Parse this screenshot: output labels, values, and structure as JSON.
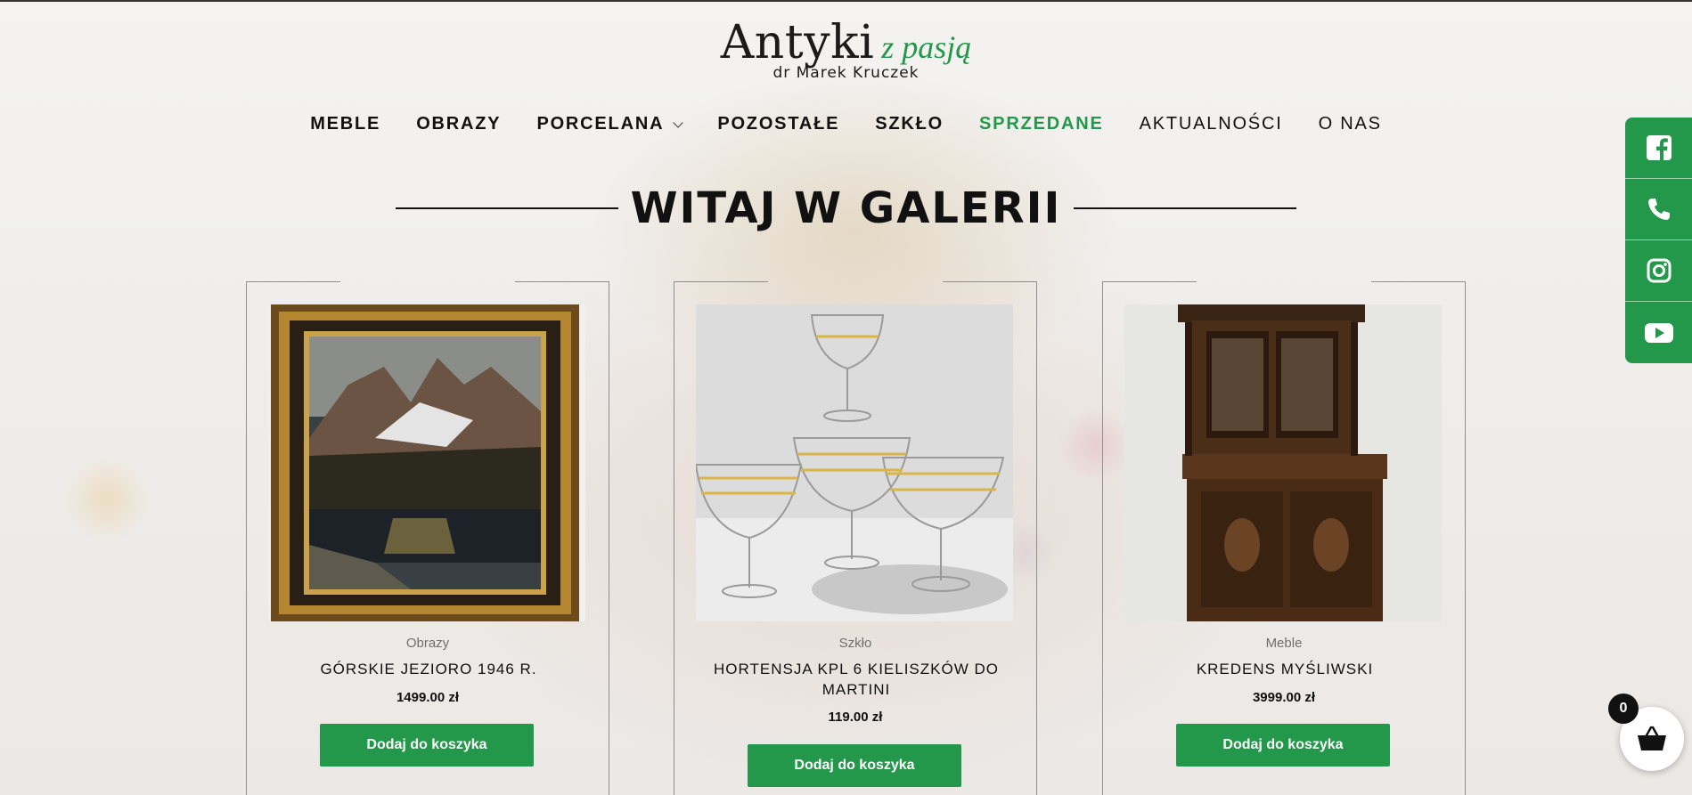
{
  "logo": {
    "title": "Antyki",
    "accent": "z pasją",
    "subtitle": "dr Marek Kruczek"
  },
  "nav": {
    "items": [
      {
        "label": "MEBLE"
      },
      {
        "label": "OBRAZY"
      },
      {
        "label": "PORCELANA"
      },
      {
        "label": "POZOSTAŁE"
      },
      {
        "label": "SZKŁO"
      },
      {
        "label": "SPRZEDANE"
      },
      {
        "label": "AKTUALNOŚCI"
      },
      {
        "label": "O NAS"
      }
    ]
  },
  "heading": "WITAJ W GALERII",
  "products": [
    {
      "category": "Obrazy",
      "name": "GÓRSKIE JEZIORO 1946 R.",
      "price": "1499.00 zł",
      "button": "Dodaj do koszyka"
    },
    {
      "category": "Szkło",
      "name": "HORTENSJA KPL 6 KIELISZKÓW DO MARTINI",
      "price": "119.00 zł",
      "button": "Dodaj do koszyka"
    },
    {
      "category": "Meble",
      "name": "KREDENS MYŚLIWSKI",
      "price": "3999.00 zł",
      "button": "Dodaj do koszyka"
    }
  ],
  "social": {
    "icons": [
      "facebook-icon",
      "phone-icon",
      "instagram-icon",
      "youtube-icon"
    ]
  },
  "cart": {
    "count": "0"
  },
  "colors": {
    "accent": "#23984a",
    "text": "#111111"
  }
}
